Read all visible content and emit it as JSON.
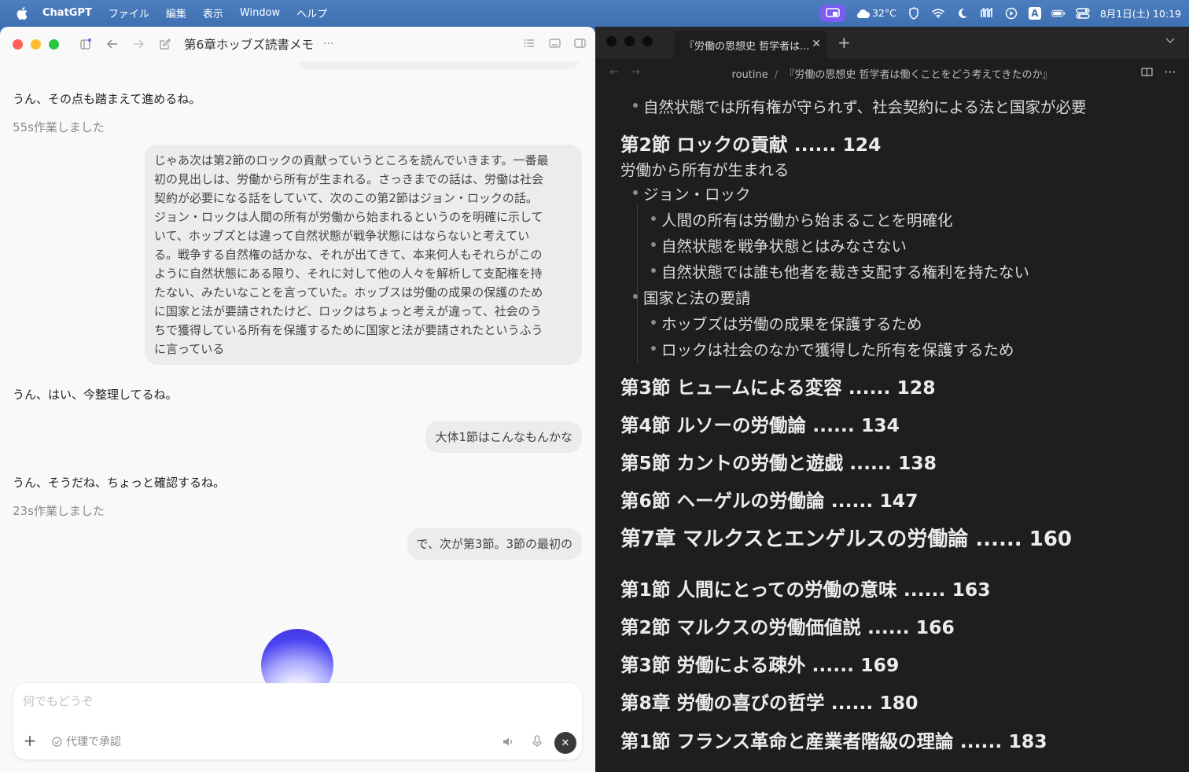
{
  "menubar": {
    "app_name": "ChatGPT",
    "menus": [
      "ファイル",
      "編集",
      "表示",
      "Window",
      "ヘルプ"
    ],
    "weather": "32°C",
    "datetime": "8月1日(土) 10:19",
    "input_source": "A"
  },
  "chat_window": {
    "title": "第6章ホッブズ読書メモ",
    "more": "···",
    "messages": {
      "ai1": "うん、その点も踏まえて進めるね。",
      "meta1": "55s作業しました",
      "user1_lines": [
        "じゃあ次は第2節のロックの貢献っていうところを読んでいきます。一番最",
        "初の見出しは、労働から所有が生まれる。さっきまでの話は、労働は社会",
        "契約が必要になる話をしていて、次のこの第2節はジョン・ロックの話。",
        "ジョン・ロックは人間の所有が労働から始まれるというのを明確に示して",
        "いて、ホッブズとは違って自然状態が戦争状態にはならないと考えてい",
        "る。戦争する自然権の話かな、それが出てきて、本来何人もそれらがこの",
        "ように自然状態にある限り、それに対して他の人々を解析して支配権を持",
        "たない、みたいなことを言っていた。ホッブスは労働の成果の保護のため",
        "に国家と法が要請されたけど、ロックはちょっと考えが違って、社会のう",
        "ちで獲得している所有を保護するために国家と法が要請されたというふう",
        "に言っている"
      ],
      "ai2": "うん、はい、今整理してるね。",
      "user2": "大体1節はこんなもんかな",
      "ai3": "うん、そうだね、ちょっと確認するね。",
      "meta2": "23s作業しました",
      "user3": "で、次が第3節。3節の最初の"
    },
    "composer": {
      "placeholder": "何でもどうぞ",
      "approve_label": "代理で承認"
    }
  },
  "note_window": {
    "tab_title": "『労働の思想史 哲学者は...",
    "breadcrumb_folder": "routine",
    "breadcrumb_sep": "/",
    "breadcrumb_file": "『労働の思想史 哲学者は働くことをどう考えてきたのか』",
    "content": {
      "b0": "自然状態では所有権が守られず、社会契約による法と国家が必要",
      "h_sec2": "第2節 ロックの貢献 ...... 124",
      "p_labor": "労働から所有が生まれる",
      "b_locke": "ジョン・ロック",
      "b_locke1": "人間の所有は労働から始まることを明確化",
      "b_locke2": "自然状態を戦争状態とはみなさない",
      "b_locke3": "自然状態では誰も他者を裁き支配する権利を持たない",
      "b_state": "国家と法の要請",
      "b_state1": "ホッブズは労働の成果を保護するため",
      "b_state2": "ロックは社会のなかで獲得した所有を保護するため",
      "h_sec3": "第3節 ヒュームによる変容 ...... 128",
      "h_sec4": "第4節 ルソーの労働論 ...... 134",
      "h_sec5": "第5節 カントの労働と遊戯 ...... 138",
      "h_sec6": "第6節 ヘーゲルの労働論 ...... 147",
      "h_ch7": "第7章 マルクスとエンゲルスの労働論 ...... 160",
      "h_ch7_1": "第1節 人間にとっての労働の意味 ...... 163",
      "h_ch7_2": "第2節 マルクスの労働価値説 ...... 166",
      "h_ch7_3": "第3節 労働による疎外 ...... 169",
      "h_ch8": "第8章 労働の喜びの哲学 ...... 180",
      "h_ch8_1": "第1節 フランス革命と産業者階級の理論 ...... 183"
    }
  }
}
